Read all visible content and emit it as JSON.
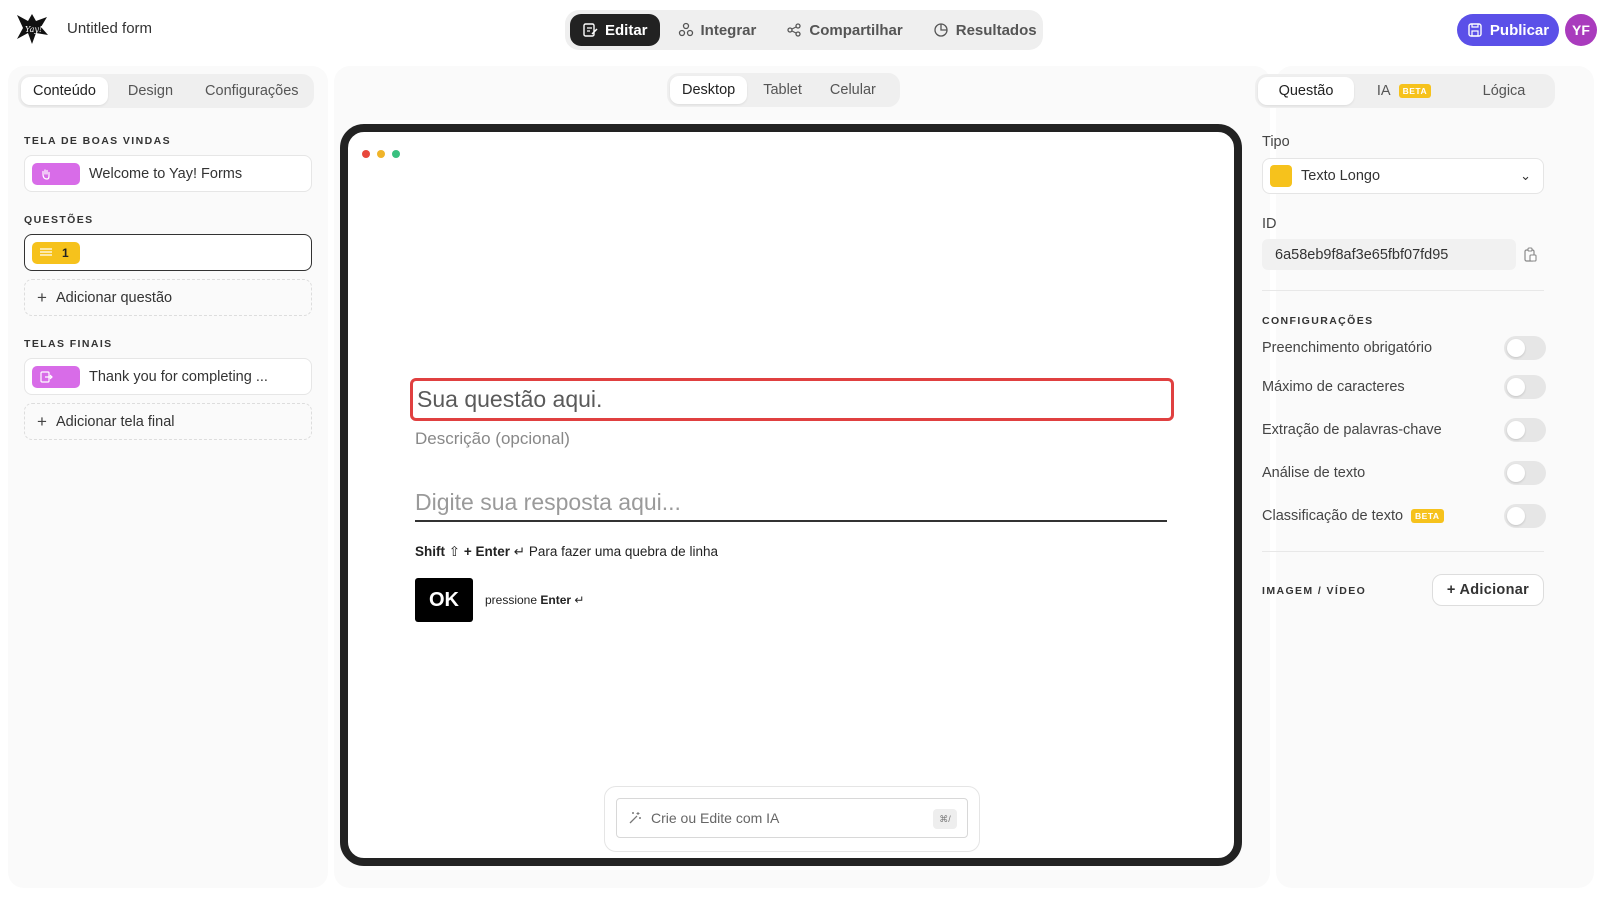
{
  "header": {
    "form_title": "Untitled form",
    "mode_tabs": [
      "Editar",
      "Integrar",
      "Compartilhar",
      "Resultados"
    ],
    "active_mode": "Editar",
    "publish_label": "Publicar",
    "avatar_initials": "YF"
  },
  "left": {
    "tabs": [
      "Conteúdo",
      "Design",
      "Configurações"
    ],
    "active_tab": "Conteúdo",
    "welcome_label": "TELA DE BOAS VINDAS",
    "welcome_card": "Welcome to Yay! Forms",
    "questions_label": "QUESTÕES",
    "question_number": "1",
    "add_question": "Adicionar questão",
    "end_label": "TELAS FINAIS",
    "end_card": "Thank you for completing ...",
    "add_end": "Adicionar tela final"
  },
  "center": {
    "device_tabs": [
      "Desktop",
      "Tablet",
      "Celular"
    ],
    "active_device": "Desktop",
    "question_placeholder": "Sua questão aqui.",
    "description_placeholder": "Descrição (opcional)",
    "answer_placeholder": "Digite sua resposta aqui...",
    "hint_shift": "Shift",
    "hint_enter": "+ Enter",
    "hint_text": "Para fazer uma quebra de linha",
    "ok_label": "OK",
    "press_text": "pressione",
    "press_key": "Enter",
    "ai_placeholder": "Crie ou Edite com IA",
    "ai_shortcut": "⌘/"
  },
  "right": {
    "tabs": [
      "Questão",
      "IA",
      "Lógica"
    ],
    "active_tab": "Questão",
    "beta": "BETA",
    "type_label": "Tipo",
    "type_value": "Texto Longo",
    "id_label": "ID",
    "id_value": "6a58eb9f8af3e65fbf07fd95",
    "settings_label": "CONFIGURAÇÕES",
    "toggles": [
      {
        "label": "Preenchimento obrigatório",
        "on": false
      },
      {
        "label": "Máximo de caracteres",
        "on": false
      },
      {
        "label": "Extração de palavras-chave",
        "on": false
      },
      {
        "label": "Análise de texto",
        "on": false
      },
      {
        "label": "Classificação de texto",
        "on": false
      }
    ],
    "media_label": "IMAGEM / VÍDEO",
    "add_media": "+ Adicionar"
  },
  "colors": {
    "accent": "#5b50e8",
    "avatar": "#a93bbd",
    "question_border": "#e04040",
    "welcome_badge": "#d86ce8",
    "question_badge": "#f6c21c"
  }
}
